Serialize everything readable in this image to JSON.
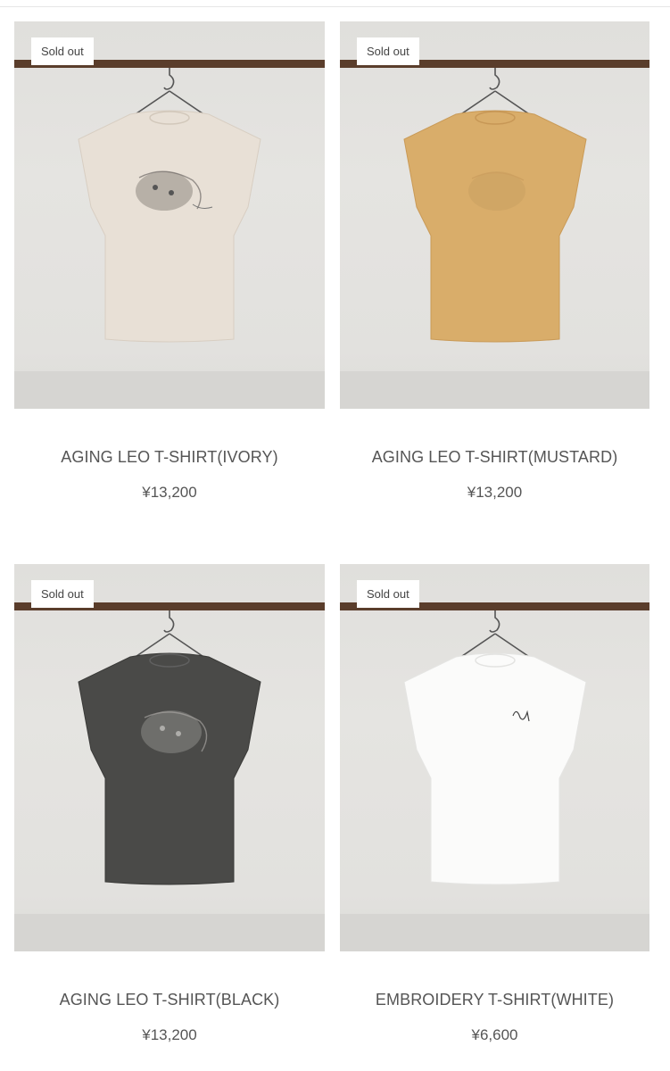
{
  "products": [
    {
      "badge": "Sold out",
      "title": "AGING LEO T-SHIRT(IVORY)",
      "price": "¥13,200",
      "shirt_color": "#e8e0d6",
      "print": "leopard"
    },
    {
      "badge": "Sold out",
      "title": "AGING LEO T-SHIRT(MUSTARD)",
      "price": "¥13,200",
      "shirt_color": "#d9ad6a",
      "print": "leopard-faint"
    },
    {
      "badge": "Sold out",
      "title": "AGING LEO T-SHIRT(BLACK)",
      "price": "¥13,200",
      "shirt_color": "#4a4a48",
      "print": "leopard"
    },
    {
      "badge": "Sold out",
      "title": "EMBROIDERY T-SHIRT(WHITE)",
      "price": "¥6,600",
      "shirt_color": "#fbfbfa",
      "print": "signature"
    }
  ],
  "colors": {
    "rail": "#5a3d2b",
    "badge_bg": "#ffffff",
    "text": "#555555"
  }
}
